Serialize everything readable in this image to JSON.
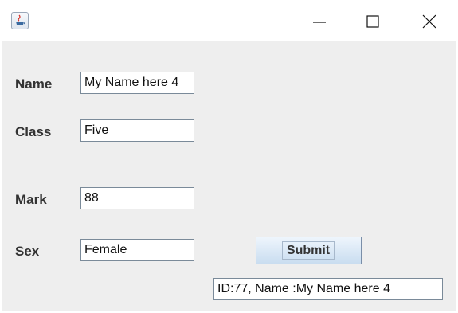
{
  "window": {
    "icon": "java-cup-icon",
    "controls": [
      "minimize-icon",
      "maximize-icon",
      "close-icon"
    ]
  },
  "form": {
    "name_label": "Name",
    "name_value": "My Name here 4",
    "class_label": "Class",
    "class_value": "Five",
    "mark_label": "Mark",
    "mark_value": "88",
    "sex_label": "Sex",
    "sex_value": "Female",
    "submit_label": "Submit",
    "result_value": "ID:77, Name :My Name here 4"
  },
  "colors": {
    "window_bg": "#eeeeee",
    "titlebar_bg": "#ffffff",
    "field_border": "#7a8a99",
    "button_gradient_top": "#eef5fc",
    "button_gradient_bottom": "#c9ddf0"
  }
}
